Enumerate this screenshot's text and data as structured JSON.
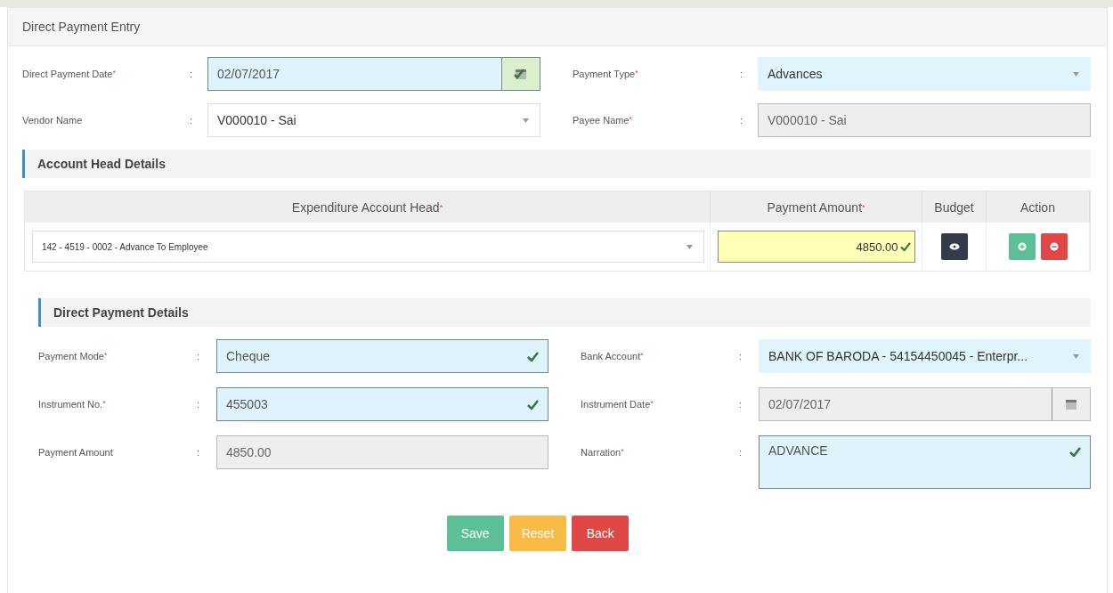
{
  "panel": {
    "title": "Direct Payment Entry"
  },
  "header_fields": [
    {
      "label": "Direct Payment Date",
      "mark": "*",
      "separator": ":",
      "value": "02/07/2017",
      "kind": "date",
      "filled": true,
      "valid": true,
      "readonly": false
    },
    {
      "label": "Payment Type",
      "mark": "*",
      "separator": ":",
      "value": "Advances",
      "kind": "select",
      "filled": true,
      "valid": false,
      "readonly": false
    },
    {
      "label": "Vendor Name",
      "separator": ":",
      "value": "V000010 - Sai",
      "kind": "select",
      "filled": false,
      "valid": false,
      "readonly": false
    },
    {
      "label": "Payee Name",
      "mark": "*",
      "separator": ":",
      "value": "V000010 - Sai",
      "kind": "text",
      "filled": false,
      "valid": false,
      "readonly": true
    }
  ],
  "account_head": {
    "title": "Account Head Details",
    "columns": [
      {
        "label": "Expenditure Account Head",
        "mark": "*"
      },
      {
        "label": "Payment Amount",
        "mark": "*"
      },
      {
        "label": "Budget"
      },
      {
        "label": "Action"
      }
    ],
    "rows": [
      {
        "account_head": "142 - 4519 - 0002 - Advance To Employee",
        "amount": "4850.00"
      }
    ]
  },
  "payment_details": {
    "title": "Direct Payment Details",
    "fields": [
      {
        "label": "Payment Mode",
        "mark": "*",
        "separator": ":",
        "value": "Cheque",
        "kind": "text",
        "filled": true,
        "valid": true,
        "readonly": false
      },
      {
        "label": "Bank Account",
        "mark": "*",
        "separator": ":",
        "value": "BANK OF BARODA - 54154450045 - Enterpr...",
        "kind": "select",
        "filled": true,
        "valid": false,
        "readonly": false
      },
      {
        "label": "Instrument No.",
        "mark": "*",
        "separator": ":",
        "value": "455003",
        "kind": "text",
        "filled": true,
        "valid": true,
        "readonly": false
      },
      {
        "label": "Instrument Date",
        "mark": "*",
        "separator": ":",
        "value": "02/07/2017",
        "kind": "date",
        "filled": false,
        "valid": false,
        "readonly": true
      },
      {
        "label": "Payment Amount",
        "separator": ":",
        "value": "4850.00",
        "kind": "text",
        "filled": false,
        "valid": false,
        "readonly": true
      },
      {
        "label": "Narration",
        "mark": "*",
        "separator": ":",
        "value": "ADVANCE",
        "kind": "textarea",
        "filled": true,
        "valid": true,
        "readonly": false
      }
    ]
  },
  "buttons": [
    {
      "label": "Save",
      "kind": "save"
    },
    {
      "label": "Reset",
      "kind": "reset"
    },
    {
      "label": "Back",
      "kind": "back"
    }
  ]
}
